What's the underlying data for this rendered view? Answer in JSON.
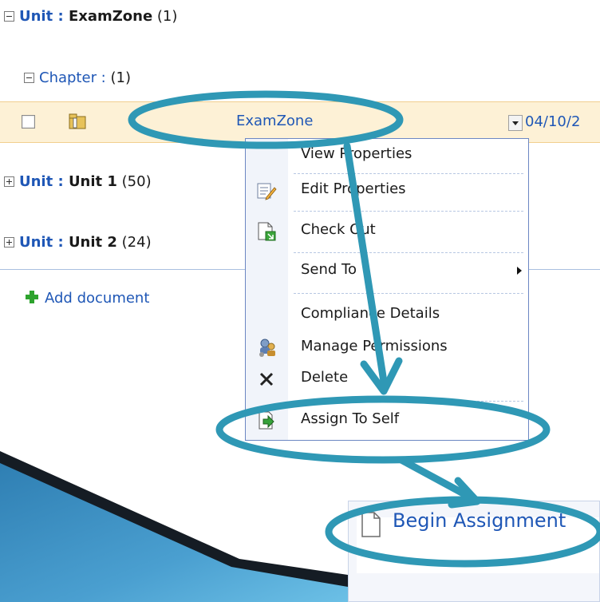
{
  "groups": {
    "examzone": {
      "prefix": "Unit : ",
      "name": "ExamZone",
      "count": " (1)"
    },
    "chapter": {
      "text": "Chapter :  ",
      "count": "(1)"
    },
    "unit1": {
      "prefix": "Unit : ",
      "name": "Unit 1",
      "count": " (50)"
    },
    "unit2": {
      "prefix": "Unit : ",
      "name": "Unit 2",
      "count": " (24)"
    }
  },
  "row": {
    "title": "ExamZone",
    "date": "04/10/2"
  },
  "add_document": {
    "label": "Add document"
  },
  "menu": {
    "items": [
      {
        "label": "View Properties",
        "icon": "view-properties-icon"
      },
      {
        "label": "Edit Properties",
        "icon": "edit-properties-icon"
      },
      {
        "label": "Check Out",
        "icon": "check-out-icon"
      },
      {
        "label": "Send To",
        "icon": ""
      },
      {
        "label": "Compliance Details",
        "icon": ""
      },
      {
        "label": "Manage Permissions",
        "icon": "manage-permissions-icon"
      },
      {
        "label": "Delete",
        "icon": "delete-icon"
      },
      {
        "label": "Assign To Self",
        "icon": "assign-to-self-icon"
      }
    ]
  },
  "panel": {
    "begin_label": "Begin Assignment"
  },
  "colors": {
    "annotation": "#2f98b5",
    "link": "#1f57b6",
    "row_highlight": "#fdf1d6",
    "wedge": "#3e8fc0"
  }
}
